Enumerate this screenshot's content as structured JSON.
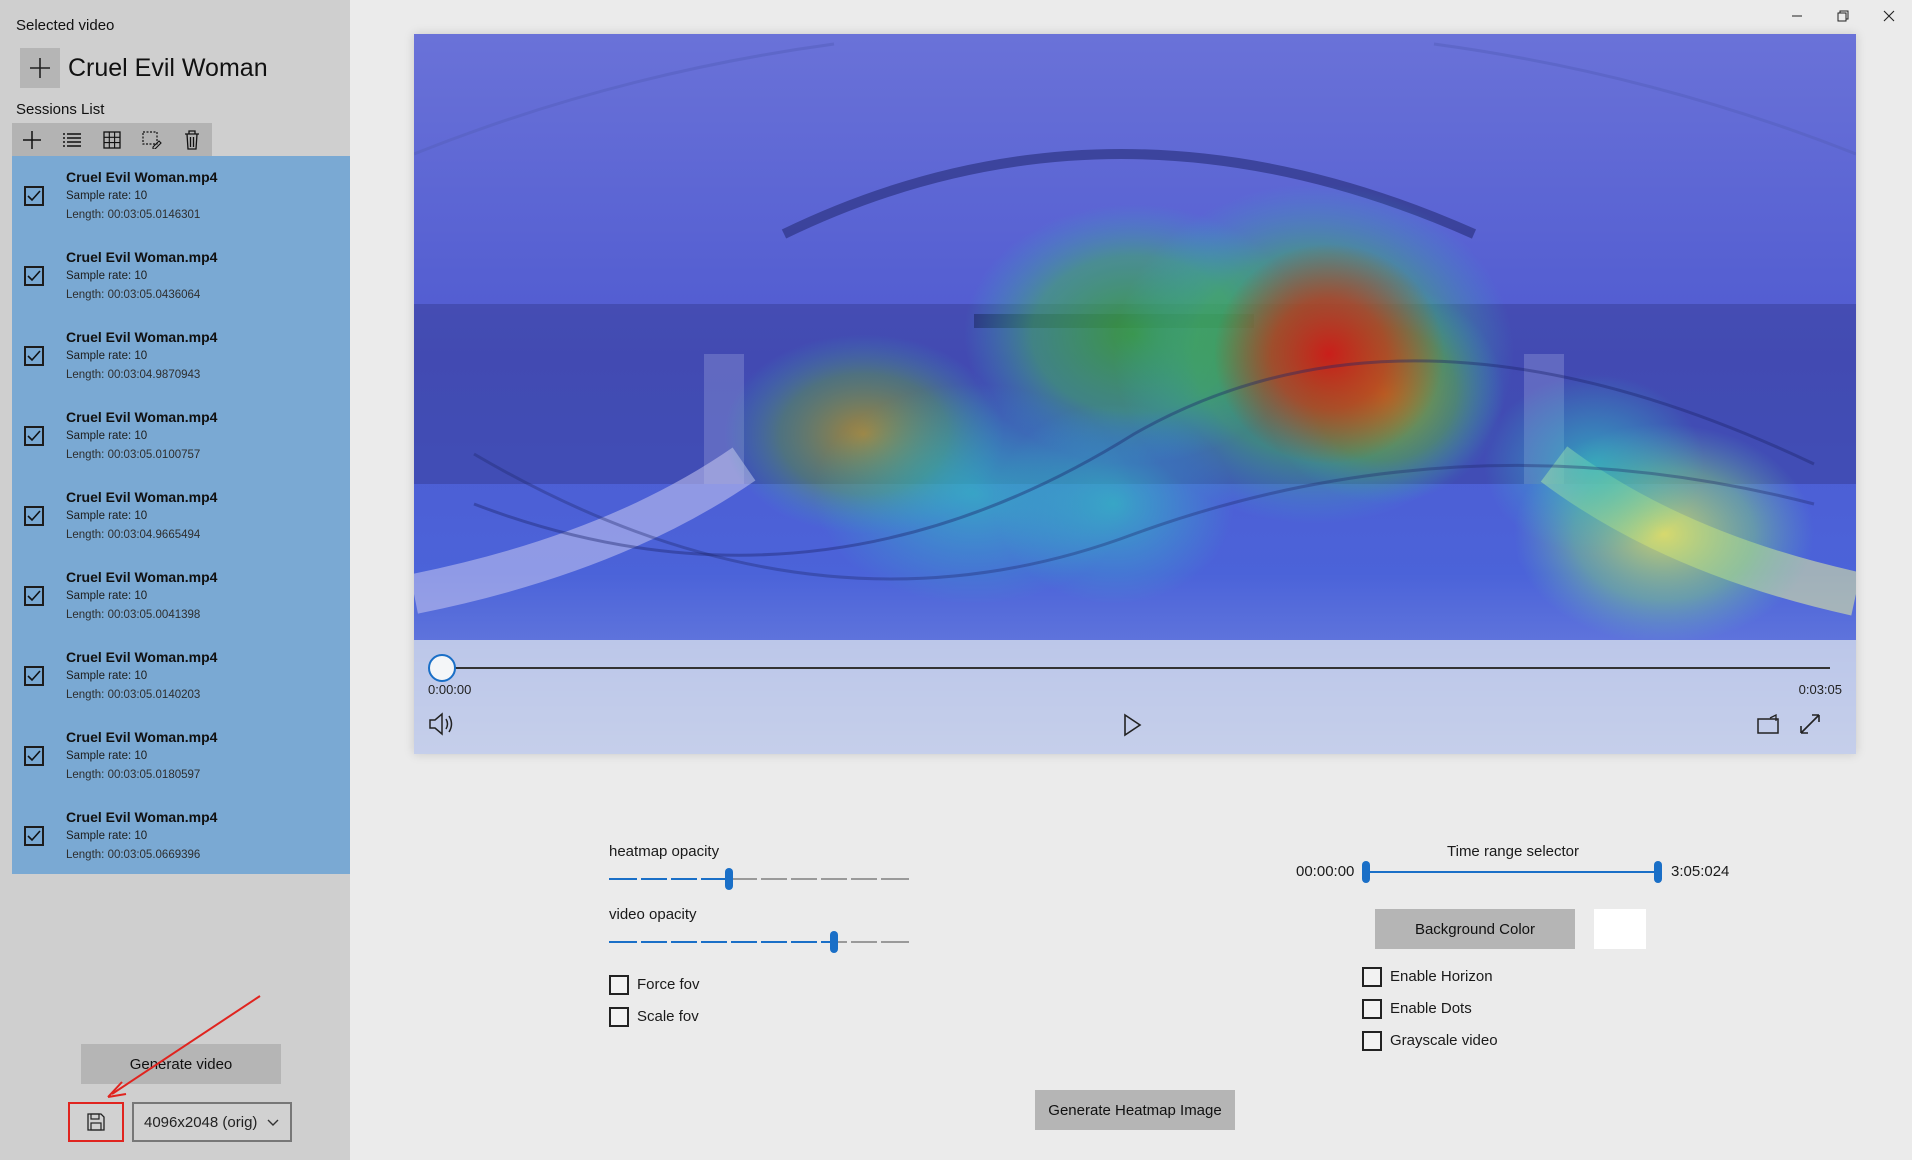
{
  "sidebar": {
    "selected_label": "Selected video",
    "video_title": "Cruel Evil Woman",
    "sessions_label": "Sessions List",
    "toolbar_icons": [
      "add-icon",
      "list-icon",
      "grid-icon",
      "edit-selection-icon",
      "trash-icon"
    ],
    "sessions": [
      {
        "name": "Cruel Evil Woman.mp4",
        "rate": "Sample rate: 10",
        "length": "Length: 00:03:05.0146301",
        "checked": true
      },
      {
        "name": "Cruel Evil Woman.mp4",
        "rate": "Sample rate: 10",
        "length": "Length: 00:03:05.0436064",
        "checked": true
      },
      {
        "name": "Cruel Evil Woman.mp4",
        "rate": "Sample rate: 10",
        "length": "Length: 00:03:04.9870943",
        "checked": true
      },
      {
        "name": "Cruel Evil Woman.mp4",
        "rate": "Sample rate: 10",
        "length": "Length: 00:03:05.0100757",
        "checked": true
      },
      {
        "name": "Cruel Evil Woman.mp4",
        "rate": "Sample rate: 10",
        "length": "Length: 00:03:04.9665494",
        "checked": true
      },
      {
        "name": "Cruel Evil Woman.mp4",
        "rate": "Sample rate: 10",
        "length": "Length: 00:03:05.0041398",
        "checked": true
      },
      {
        "name": "Cruel Evil Woman.mp4",
        "rate": "Sample rate: 10",
        "length": "Length: 00:03:05.0140203",
        "checked": true
      },
      {
        "name": "Cruel Evil Woman.mp4",
        "rate": "Sample rate: 10",
        "length": "Length: 00:03:05.0180597",
        "checked": true
      },
      {
        "name": "Cruel Evil Woman.mp4",
        "rate": "Sample rate: 10",
        "length": "Length: 00:03:05.0669396",
        "checked": true
      }
    ],
    "generate_video_label": "Generate video",
    "resolution_selected": "4096x2048 (orig)"
  },
  "player": {
    "time_current": "0:00:00",
    "time_total": "0:03:05",
    "progress": 0.0
  },
  "settings": {
    "heatmap_opacity_label": "heatmap opacity",
    "heatmap_opacity_value": 0.4,
    "video_opacity_label": "video opacity",
    "video_opacity_value": 0.75,
    "force_fov_label": "Force fov",
    "force_fov_checked": false,
    "scale_fov_label": "Scale fov",
    "scale_fov_checked": false,
    "time_range_label": "Time range selector",
    "time_range_start": "00:00:00",
    "time_range_end": "3:05:024",
    "background_color_label": "Background Color",
    "background_color": "#ffffff",
    "enable_horizon_label": "Enable Horizon",
    "enable_dots_label": "Enable Dots",
    "grayscale_label": "Grayscale video",
    "generate_heatmap_label": "Generate Heatmap Image"
  },
  "colors": {
    "accent": "#1a6fc7",
    "sessions_bg": "#7aa9d3",
    "annotation": "#e0241f"
  }
}
